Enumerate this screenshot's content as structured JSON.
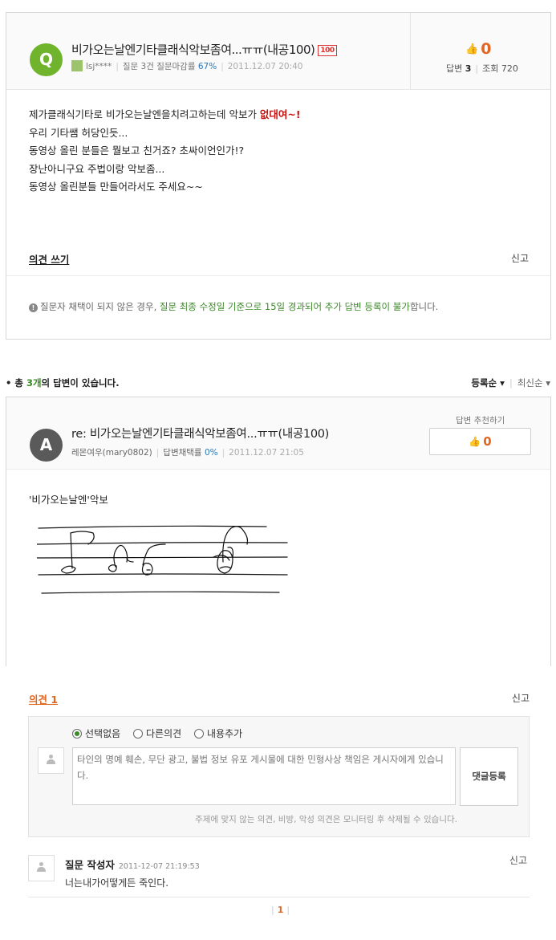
{
  "question": {
    "avatar_letter": "Q",
    "title": "비가오는날엔기타클래식악보좀여...ㅠㅠ(내공100)",
    "badge": "100",
    "author": "lsj****",
    "question_count": "질문 3건",
    "close_rate_label": "질문마감률",
    "close_rate": "67%",
    "date": "2011.12.07 20:40",
    "likes": "0",
    "answers_label": "답변",
    "answers": "3",
    "views_label": "조회",
    "views": "720",
    "body_line1_a": " 제가클래식기타로 비가오는날엔을치려고하는데 악보가 ",
    "body_line1_highlight": "없대여~!",
    "body_lines": [
      "우리 기타쌤 허당인듯...",
      "동영상 올린 분들은 뭘보고 친거죠? 초싸이언인가!?",
      "장난아니구요 주법이랑 악보좀...",
      "동영상 올린분들 만들어라서도 주세요~~"
    ],
    "write_opinion": "의견 쓰기",
    "report": "신고",
    "notice_a": "질문자 채택이 되지 않은 경우, ",
    "notice_green": "질문 최종 수정일 기준으로 15일 경과되어 추가 답변 등록이 불가",
    "notice_b": "합니다."
  },
  "answers_header": {
    "prefix": "총 ",
    "count": "3개",
    "suffix": "의 답변이 있습니다.",
    "sort_active": "등록순",
    "sort_other": "최신순"
  },
  "answer": {
    "avatar_letter": "A",
    "title": "re: 비가오는날엔기타클래식악보좀여...ㅠㅠ(내공100)",
    "author": "레몬여우(mary0802)",
    "adopt_rate_label": "답변채택률",
    "adopt_rate": "0%",
    "date": "2011.12.07 21:05",
    "recommend_label": "답변 추천하기",
    "recommend_count": "0",
    "body": "'비가오는날엔'악보"
  },
  "comments": {
    "title": "의견 1",
    "report": "신고",
    "radio_options": [
      "선택없음",
      "다른의견",
      "내용추가"
    ],
    "placeholder": "타인의 명예 훼손, 무단 광고, 불법 정보 유포 게시물에 대한 민형사상 책임은 게시자에게 있습니다.",
    "submit": "댓글등록",
    "note": "주제에 맞지 않는 의견, 비방, 악성 의견은 모니터링 후 삭제될 수 있습니다.",
    "items": [
      {
        "author": "질문 작성자",
        "date": "2011-12-07 21:19:53",
        "report": "신고",
        "text": "너는내가어떻게든 죽인다."
      }
    ],
    "page": "1"
  },
  "colors": {
    "green": "#6fb42c",
    "orange": "#e2661f",
    "red": "#c8100e",
    "link_green": "#3a8a26"
  }
}
